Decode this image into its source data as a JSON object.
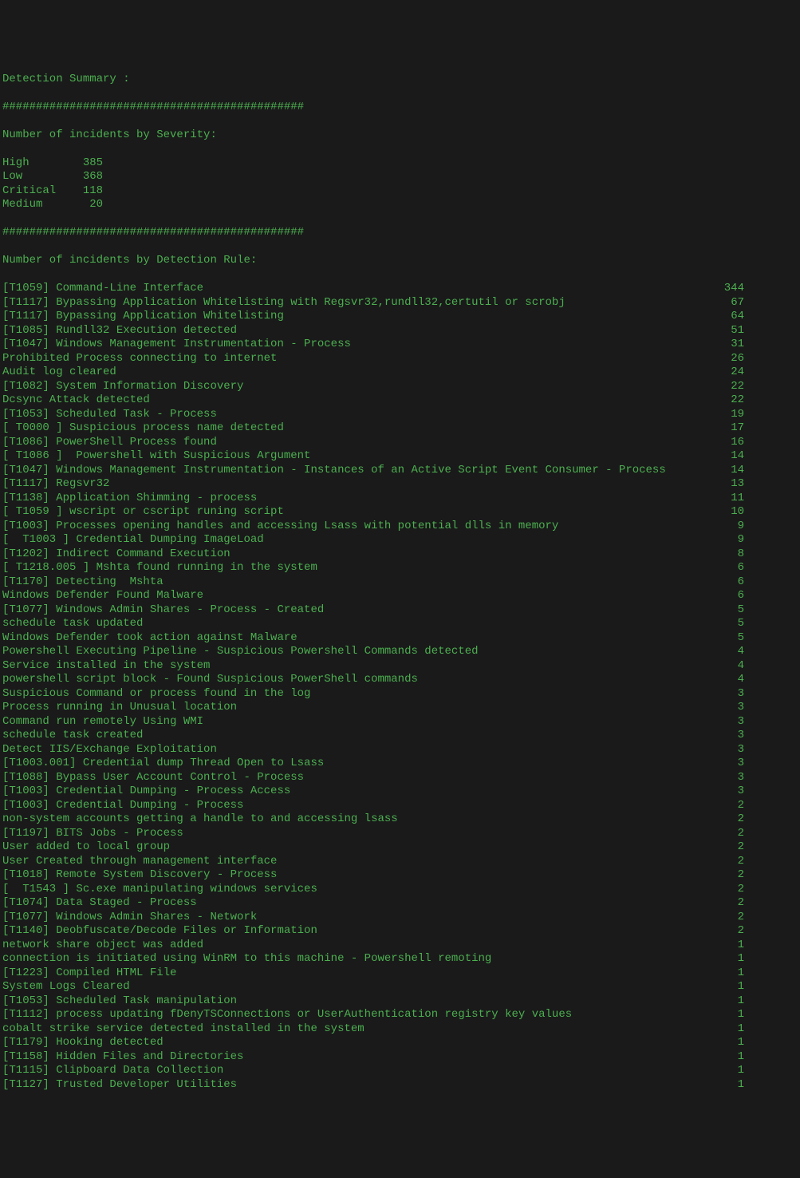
{
  "header": {
    "title": "Detection Summary :",
    "divider": "#############################################",
    "severity_heading": "Number of incidents by Severity:",
    "rules_heading": "Number of incidents by Detection Rule:"
  },
  "severity": [
    {
      "label": "High        385"
    },
    {
      "label": "Low         368"
    },
    {
      "label": "Critical    118"
    },
    {
      "label": "Medium       20"
    }
  ],
  "rules": [
    {
      "label": "[T1059] Command-Line Interface",
      "count": "344"
    },
    {
      "label": "[T1117] Bypassing Application Whitelisting with Regsvr32,rundll32,certutil or scrobj",
      "count": "67"
    },
    {
      "label": "[T1117] Bypassing Application Whitelisting",
      "count": "64"
    },
    {
      "label": "[T1085] Rundll32 Execution detected",
      "count": "51"
    },
    {
      "label": "[T1047] Windows Management Instrumentation - Process",
      "count": "31"
    },
    {
      "label": "Prohibited Process connecting to internet",
      "count": "26"
    },
    {
      "label": "Audit log cleared",
      "count": "24"
    },
    {
      "label": "[T1082] System Information Discovery",
      "count": "22"
    },
    {
      "label": "Dcsync Attack detected",
      "count": "22"
    },
    {
      "label": "[T1053] Scheduled Task - Process",
      "count": "19"
    },
    {
      "label": "[ T0000 ] Suspicious process name detected",
      "count": "17"
    },
    {
      "label": "[T1086] PowerShell Process found",
      "count": "16"
    },
    {
      "label": "[ T1086 ]  Powershell with Suspicious Argument",
      "count": "14"
    },
    {
      "label": "[T1047] Windows Management Instrumentation - Instances of an Active Script Event Consumer - Process",
      "count": "14"
    },
    {
      "label": "[T1117] Regsvr32",
      "count": "13"
    },
    {
      "label": "[T1138] Application Shimming - process",
      "count": "11"
    },
    {
      "label": "[ T1059 ] wscript or cscript runing script",
      "count": "10"
    },
    {
      "label": "[T1003] Processes opening handles and accessing Lsass with potential dlls in memory",
      "count": "9"
    },
    {
      "label": "[  T1003 ] Credential Dumping ImageLoad",
      "count": "9"
    },
    {
      "label": "[T1202] Indirect Command Execution",
      "count": "8"
    },
    {
      "label": "[ T1218.005 ] Mshta found running in the system",
      "count": "6"
    },
    {
      "label": "[T1170] Detecting  Mshta",
      "count": "6"
    },
    {
      "label": "Windows Defender Found Malware",
      "count": "6"
    },
    {
      "label": "[T1077] Windows Admin Shares - Process - Created",
      "count": "5"
    },
    {
      "label": "schedule task updated",
      "count": "5"
    },
    {
      "label": "Windows Defender took action against Malware",
      "count": "5"
    },
    {
      "label": "Powershell Executing Pipeline - Suspicious Powershell Commands detected",
      "count": "4"
    },
    {
      "label": "Service installed in the system",
      "count": "4"
    },
    {
      "label": "powershell script block - Found Suspicious PowerShell commands",
      "count": "4"
    },
    {
      "label": "Suspicious Command or process found in the log",
      "count": "3"
    },
    {
      "label": "Process running in Unusual location",
      "count": "3"
    },
    {
      "label": "Command run remotely Using WMI",
      "count": "3"
    },
    {
      "label": "schedule task created",
      "count": "3"
    },
    {
      "label": "Detect IIS/Exchange Exploitation",
      "count": "3"
    },
    {
      "label": "[T1003.001] Credential dump Thread Open to Lsass",
      "count": "3"
    },
    {
      "label": "[T1088] Bypass User Account Control - Process",
      "count": "3"
    },
    {
      "label": "[T1003] Credential Dumping - Process Access",
      "count": "3"
    },
    {
      "label": "[T1003] Credential Dumping - Process",
      "count": "2"
    },
    {
      "label": "non-system accounts getting a handle to and accessing lsass",
      "count": "2"
    },
    {
      "label": "[T1197] BITS Jobs - Process",
      "count": "2"
    },
    {
      "label": "User added to local group",
      "count": "2"
    },
    {
      "label": "User Created through management interface",
      "count": "2"
    },
    {
      "label": "[T1018] Remote System Discovery - Process",
      "count": "2"
    },
    {
      "label": "[  T1543 ] Sc.exe manipulating windows services",
      "count": "2"
    },
    {
      "label": "[T1074] Data Staged - Process",
      "count": "2"
    },
    {
      "label": "[T1077] Windows Admin Shares - Network",
      "count": "2"
    },
    {
      "label": "[T1140] Deobfuscate/Decode Files or Information",
      "count": "2"
    },
    {
      "label": "network share object was added",
      "count": "1"
    },
    {
      "label": "connection is initiated using WinRM to this machine - Powershell remoting",
      "count": "1"
    },
    {
      "label": "[T1223] Compiled HTML File",
      "count": "1"
    },
    {
      "label": "System Logs Cleared",
      "count": "1"
    },
    {
      "label": "[T1053] Scheduled Task manipulation",
      "count": "1"
    },
    {
      "label": "[T1112] process updating fDenyTSConnections or UserAuthentication registry key values",
      "count": "1"
    },
    {
      "label": "cobalt strike service detected installed in the system",
      "count": "1"
    },
    {
      "label": "[T1179] Hooking detected",
      "count": "1"
    },
    {
      "label": "[T1158] Hidden Files and Directories",
      "count": "1"
    },
    {
      "label": "[T1115] Clipboard Data Collection",
      "count": "1"
    },
    {
      "label": "[T1127] Trusted Developer Utilities",
      "count": "1"
    }
  ]
}
